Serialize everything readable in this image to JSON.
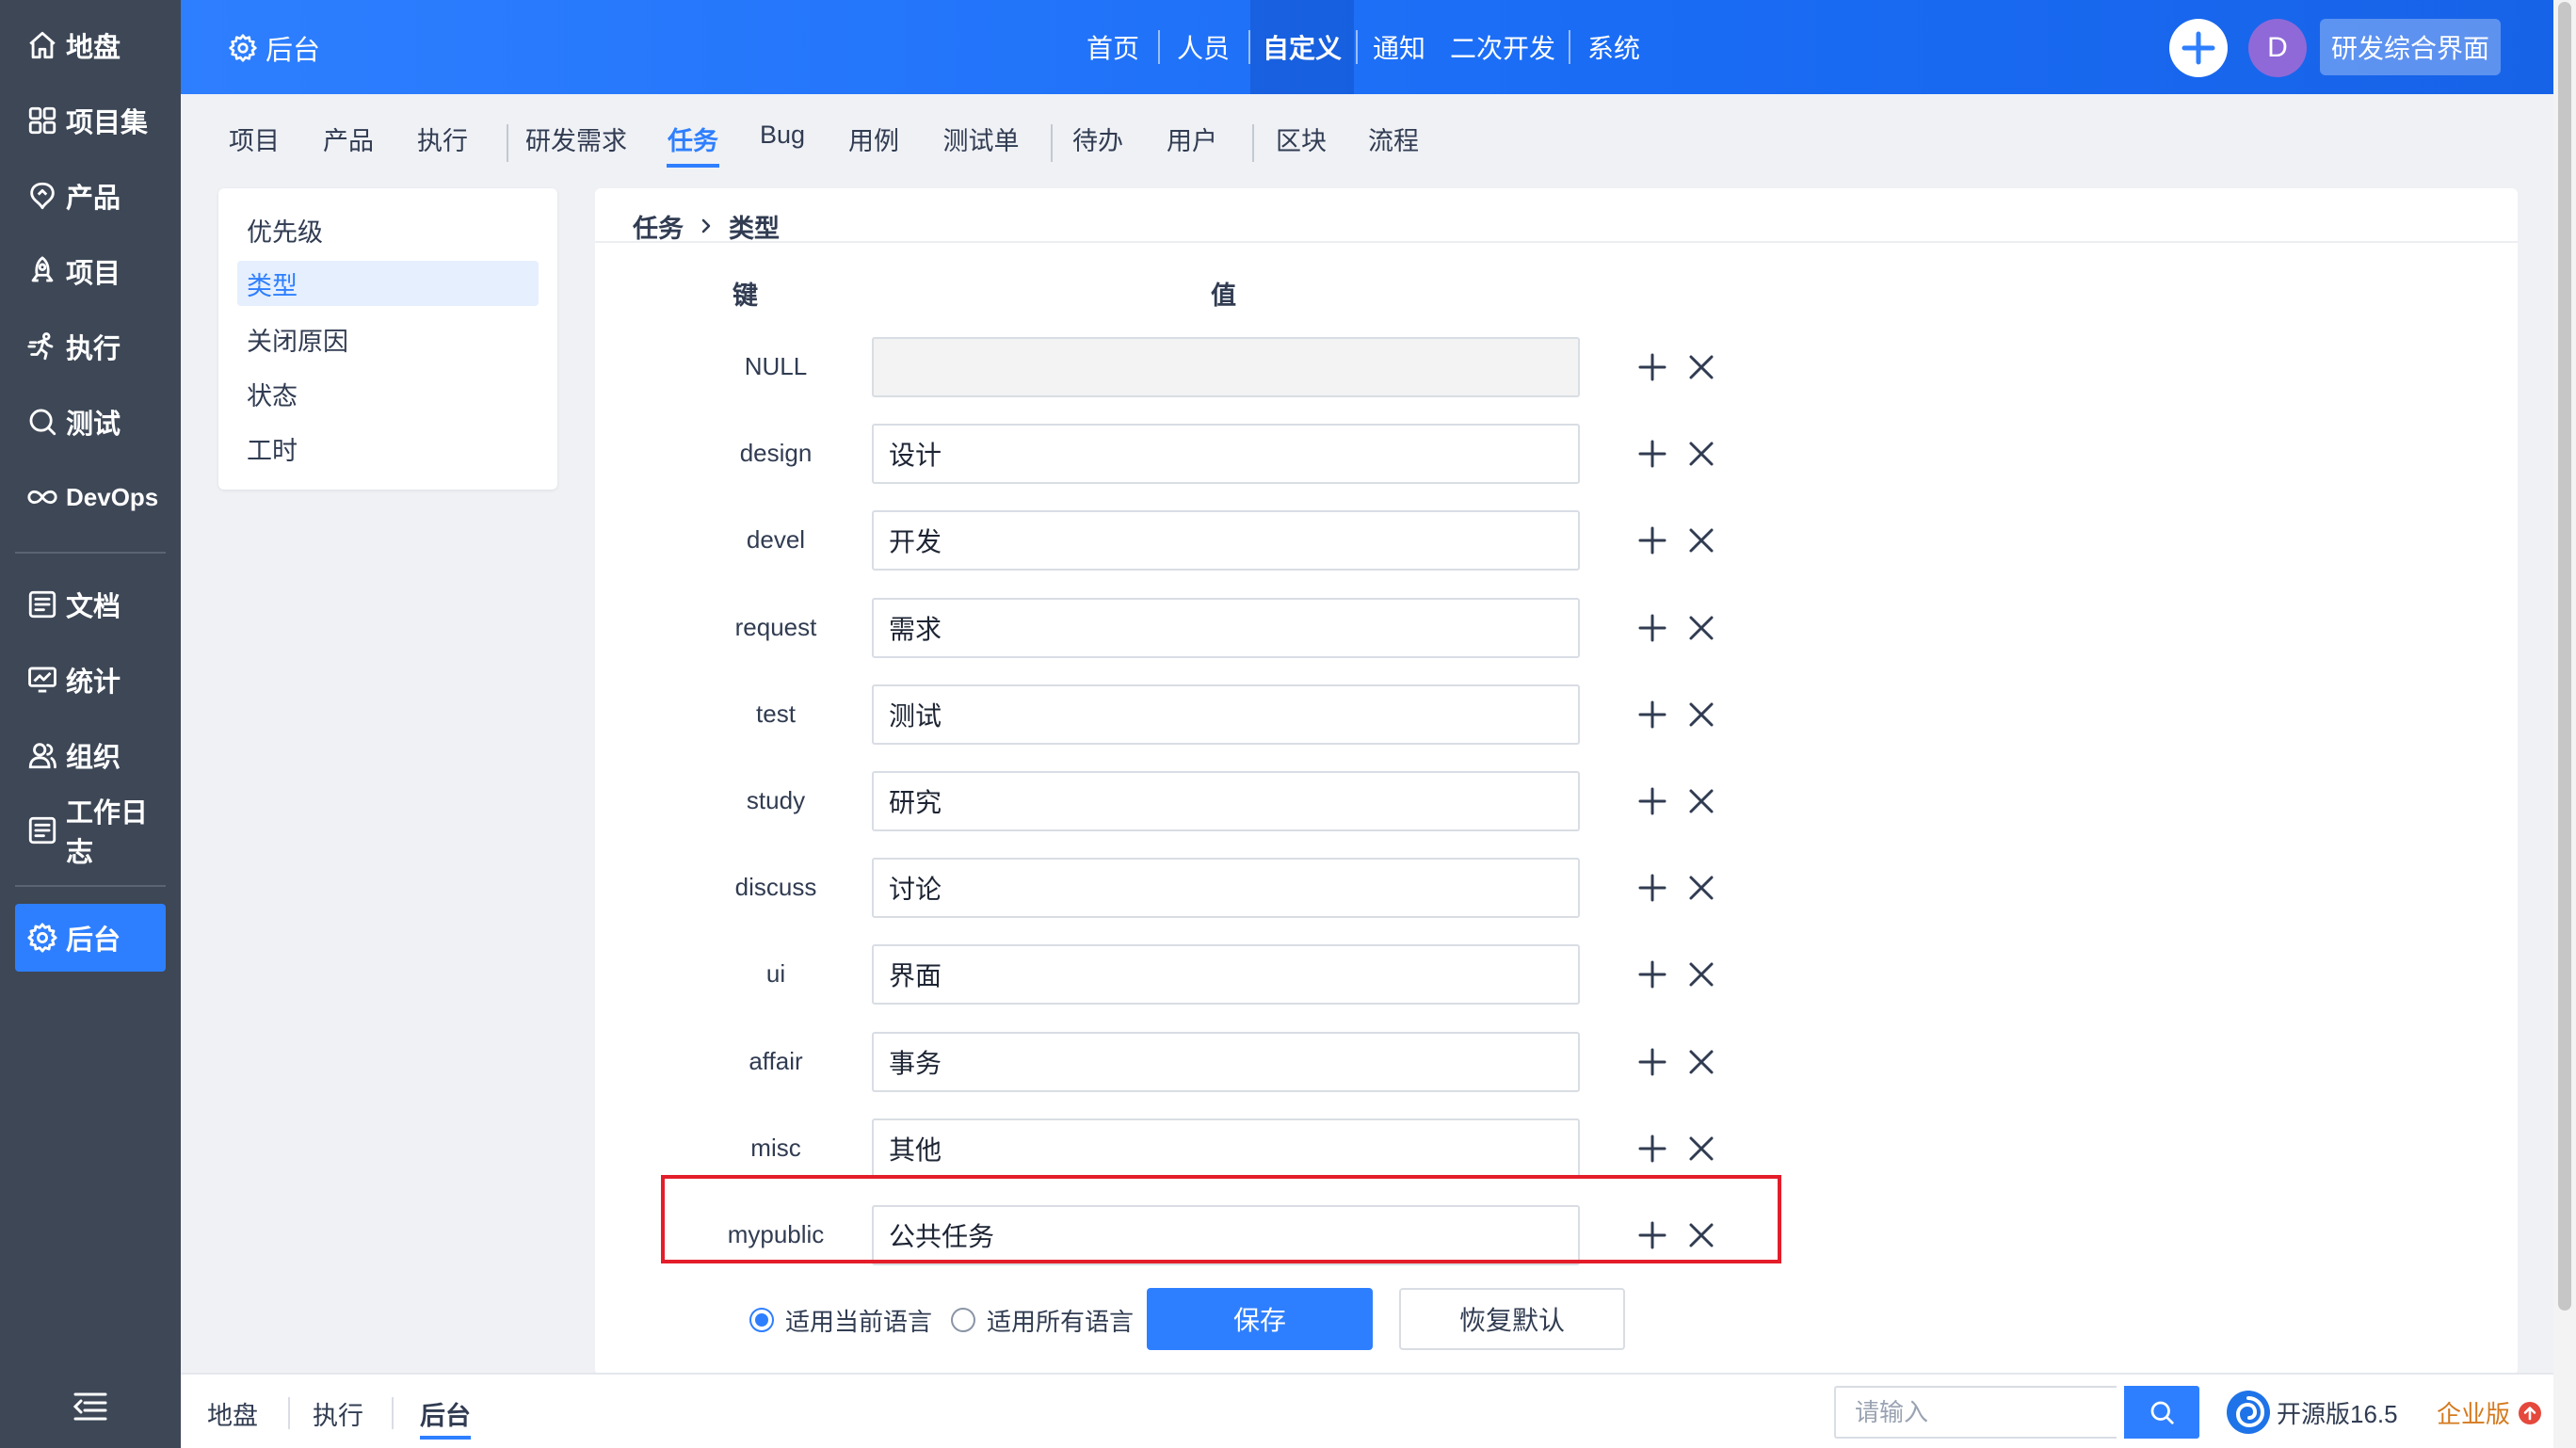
{
  "sidebar": {
    "items": [
      {
        "label": "地盘",
        "icon": "home-icon"
      },
      {
        "label": "项目集",
        "icon": "grid-icon"
      },
      {
        "label": "产品",
        "icon": "product-icon"
      },
      {
        "label": "项目",
        "icon": "rocket-icon"
      },
      {
        "label": "执行",
        "icon": "run-icon"
      },
      {
        "label": "测试",
        "icon": "magnifier-icon"
      },
      {
        "label": "DevOps",
        "icon": "infinity-icon"
      },
      {
        "label": "文档",
        "icon": "doc-icon"
      },
      {
        "label": "统计",
        "icon": "monitor-chart-icon"
      },
      {
        "label": "组织",
        "icon": "people-icon"
      },
      {
        "label": "工作日志",
        "icon": "doc-icon"
      },
      {
        "label": "后台",
        "icon": "gear-icon",
        "active": true
      }
    ],
    "collapse_icon": "menu-collapse-icon"
  },
  "header": {
    "title": "后台",
    "nav": [
      "首页",
      "人员",
      "自定义",
      "通知",
      "二次开发",
      "系统"
    ],
    "active_nav": "自定义",
    "avatar_letter": "D",
    "workspace_button": "研发综合界面",
    "accent_color": "#2e7fff"
  },
  "subnav": {
    "items": [
      "项目",
      "产品",
      "执行",
      "研发需求",
      "任务",
      "Bug",
      "用例",
      "测试单",
      "待办",
      "用户",
      "区块",
      "流程"
    ],
    "active": "任务"
  },
  "left_menu": {
    "items": [
      "优先级",
      "类型",
      "关闭原因",
      "状态",
      "工时"
    ],
    "active": "类型"
  },
  "breadcrumb": {
    "first": "任务",
    "second": "类型"
  },
  "table": {
    "key_header": "键",
    "value_header": "值",
    "rows": [
      {
        "key": "NULL",
        "value": "",
        "disabled": true
      },
      {
        "key": "design",
        "value": "设计"
      },
      {
        "key": "devel",
        "value": "开发"
      },
      {
        "key": "request",
        "value": "需求"
      },
      {
        "key": "test",
        "value": "测试"
      },
      {
        "key": "study",
        "value": "研究"
      },
      {
        "key": "discuss",
        "value": "讨论"
      },
      {
        "key": "ui",
        "value": "界面"
      },
      {
        "key": "affair",
        "value": "事务"
      },
      {
        "key": "misc",
        "value": "其他"
      },
      {
        "key": "mypublic",
        "value": "公共任务",
        "highlighted": true
      }
    ]
  },
  "form": {
    "lang_current": "适用当前语言",
    "lang_all": "适用所有语言",
    "lang_selected": "current",
    "save_label": "保存",
    "restore_label": "恢复默认"
  },
  "footer": {
    "breadcrumbs": [
      "地盘",
      "执行",
      "后台"
    ],
    "active": "后台",
    "search_placeholder": "请输入",
    "edition": "开源版16.5",
    "upgrade": "企业版",
    "upgrade_color": "#d47a1f"
  }
}
